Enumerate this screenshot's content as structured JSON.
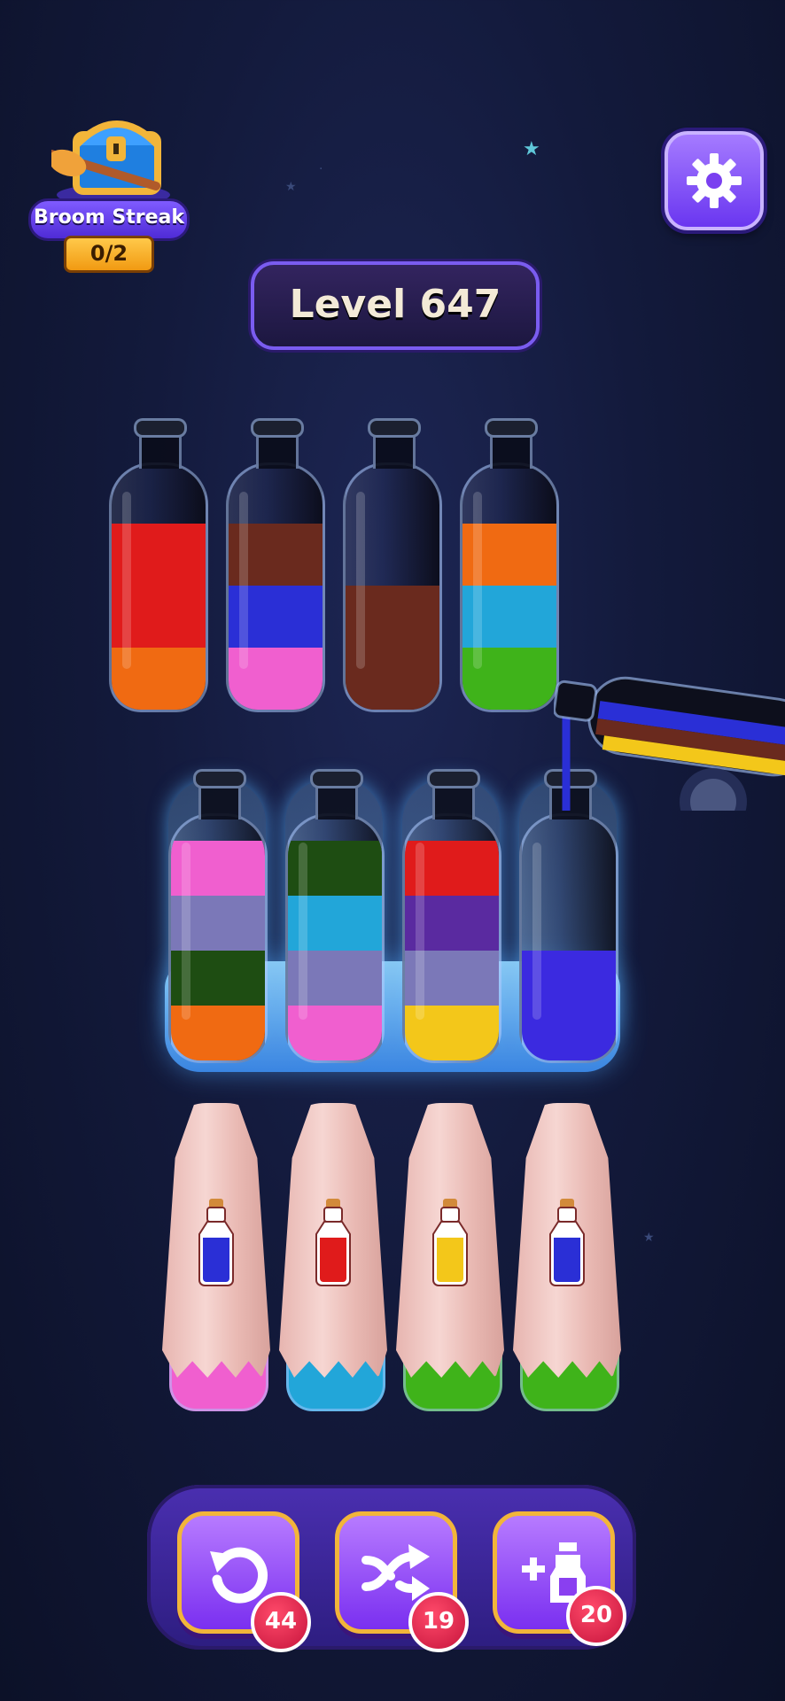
{
  "streak": {
    "label": "Broom Streak",
    "count": "0/2"
  },
  "level": {
    "label": "Level 647"
  },
  "tools": [
    {
      "name": "undo",
      "count": "44"
    },
    {
      "name": "shuffle",
      "count": "19"
    },
    {
      "name": "add-bottle",
      "count": "20"
    }
  ],
  "colors": {
    "red": "#e01b1b",
    "orange": "#f06a12",
    "brown": "#6a2a1e",
    "blue": "#2a2fd6",
    "pink": "#f05fcf",
    "cyan": "#22a6d9",
    "green": "#3fb31a",
    "lavender": "#7b78b8",
    "darkgreen": "#1e4d12",
    "purple": "#5a2aa0",
    "yellow": "#f3c71a",
    "violet": "#3b2ae0"
  },
  "bottles_row1": [
    {
      "layers": [
        "orange",
        "red",
        "red"
      ]
    },
    {
      "layers": [
        "pink",
        "blue",
        "brown"
      ]
    },
    {
      "layers": [
        "brown",
        "brown"
      ]
    },
    {
      "layers": [
        "green",
        "cyan",
        "orange"
      ]
    }
  ],
  "bottles_row2": [
    {
      "layers": [
        "orange",
        "darkgreen",
        "lavender",
        "pink"
      ]
    },
    {
      "layers": [
        "pink",
        "lavender",
        "cyan",
        "darkgreen"
      ]
    },
    {
      "layers": [
        "yellow",
        "lavender",
        "purple",
        "red"
      ]
    },
    {
      "layers": [
        "violet",
        "violet"
      ]
    }
  ],
  "covered_bottles": [
    {
      "potion": "blue",
      "base": "pink"
    },
    {
      "potion": "red",
      "base": "cyan"
    },
    {
      "potion": "yellow",
      "base": "green"
    },
    {
      "potion": "blue",
      "base": "green"
    }
  ]
}
